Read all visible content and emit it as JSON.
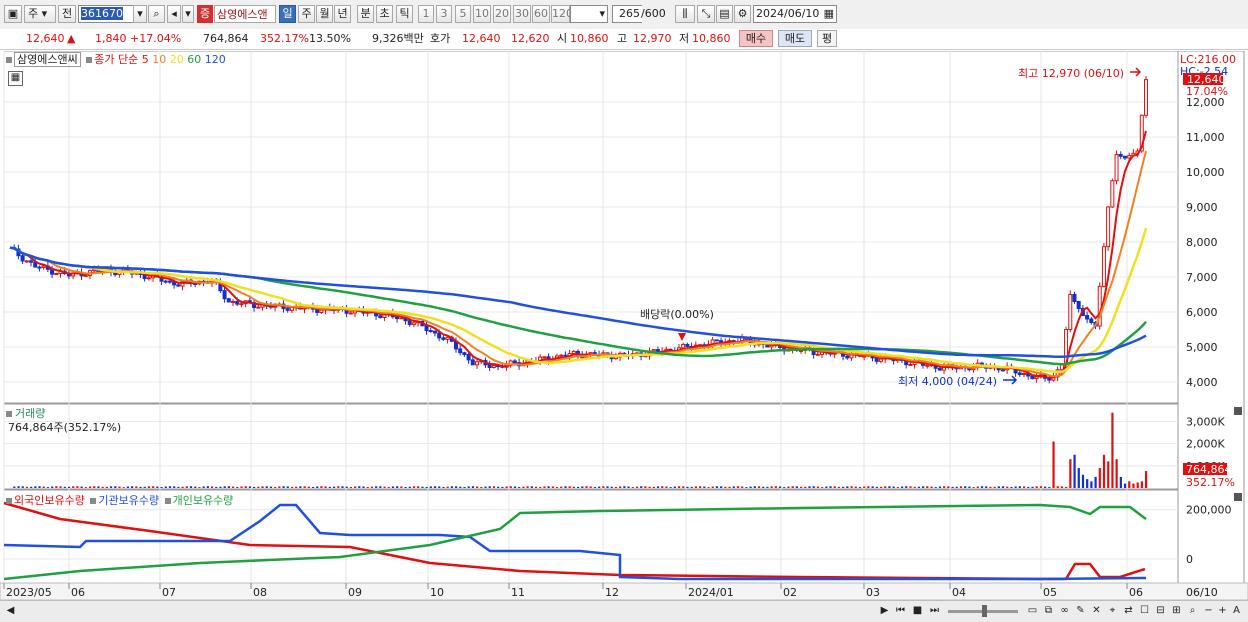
{
  "toolbar": {
    "market": "주",
    "prev": "전",
    "code": "361670",
    "stock_badge": "증",
    "stock_name": "삼영에스앤",
    "periods": [
      "일",
      "주",
      "월",
      "년",
      "분",
      "초",
      "틱"
    ],
    "active_period": "일",
    "intervals": [
      "1",
      "3",
      "5",
      "10",
      "20",
      "30",
      "60",
      "120"
    ],
    "count": "265",
    "count_max": "/600",
    "date": "2024/06/10"
  },
  "quote": {
    "price": "12,640",
    "arrow": "▲",
    "change": "1,840",
    "change_pct": "+17.04%",
    "volume": "764,864",
    "volume_pct": "352.17%",
    "turnover_pct": "13.50%",
    "amount": "9,326백만",
    "hoga_label": "호가",
    "ask": "12,640",
    "bid": "12,620",
    "open_label": "시",
    "open": "10,860",
    "high_label": "고",
    "high": "12,970",
    "low_label": "저",
    "low": "10,860",
    "buy": "매수",
    "sell": "매도",
    "eval": "평"
  },
  "price_panel": {
    "name": "삼영에스앤씨",
    "indicator": "종가 단순",
    "ma_periods": [
      "5",
      "10",
      "20",
      "60",
      "120"
    ],
    "ma_colors": [
      "#e01010",
      "#f08020",
      "#f0e020",
      "#20a040",
      "#2050e0"
    ],
    "annotation_high": "최고 12,970 (06/10)",
    "annotation_low": "최저 4,000 (04/24)",
    "annotation_dividend": "배당락(0.00%)",
    "lc": "LC:216.00",
    "hc": "HC:-2.54",
    "last_price": "12,640",
    "last_pct": "17.04%",
    "y_ticks": [
      "12,000",
      "11,000",
      "10,000",
      "9,000",
      "8,000",
      "7,000",
      "6,000",
      "5,000",
      "4,000"
    ]
  },
  "volume_panel": {
    "title": "거래량",
    "value": "764,864주(352.17%)",
    "y_ticks": [
      "3,000K",
      "2,000K",
      "1,000K"
    ],
    "last_volume": "764,864",
    "last_pct": "352.17%"
  },
  "holding_panel": {
    "series": [
      "외국인보유수량",
      "기관보유수량",
      "개인보유수량"
    ],
    "colors": [
      "#e01010",
      "#2050e0",
      "#20a040"
    ],
    "y_ticks": [
      "200,000",
      "0"
    ]
  },
  "x_axis": [
    "2023/05",
    "06",
    "07",
    "08",
    "09",
    "10",
    "11",
    "12",
    "2024/01",
    "02",
    "03",
    "04",
    "05",
    "06"
  ],
  "x_axis_right": "06/10"
}
